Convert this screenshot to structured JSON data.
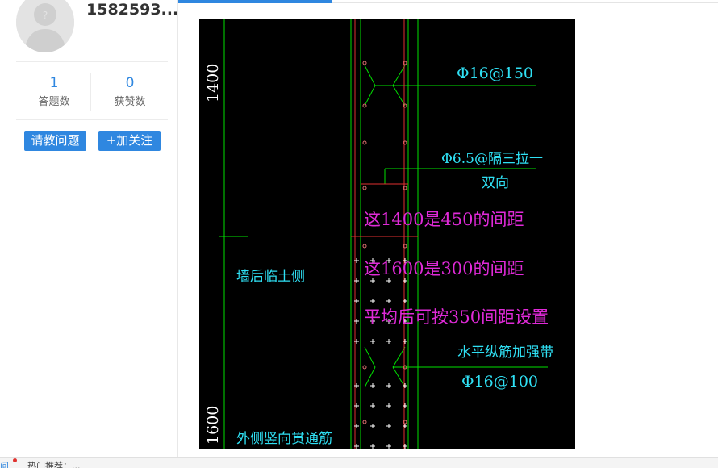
{
  "profile": {
    "username": "1582593...",
    "stats": [
      {
        "value": "1",
        "label": "答题数"
      },
      {
        "value": "0",
        "label": "获赞数"
      }
    ],
    "buttons": {
      "ask": "请教问题",
      "follow": "+加关注"
    }
  },
  "image": {
    "dimension_labels": [
      "1400",
      "1600"
    ],
    "callouts": {
      "rebar_top": "Φ16@150",
      "tie_line1": "Φ6.5@隔三拉一",
      "tie_line2": "双向",
      "wall_side": "墙后临土侧",
      "outer_rebar": "外侧竖向贯通筋",
      "band_line1": "水平纵筋加强带",
      "band_line2": "Φ16@100"
    },
    "annotations": [
      "这1400是450的间距",
      "这1600是300的间距",
      "平均后可按350间距设置"
    ]
  },
  "bottom_bar": {
    "link": "问",
    "text": "热门推荐：..."
  },
  "colors": {
    "accent": "#2f87e0",
    "cad_background": "#000000",
    "cad_green": "#00e000",
    "cad_red": "#e03030",
    "cad_cyan": "#2fe0f4",
    "annotation_magenta": "#e02ad8"
  }
}
